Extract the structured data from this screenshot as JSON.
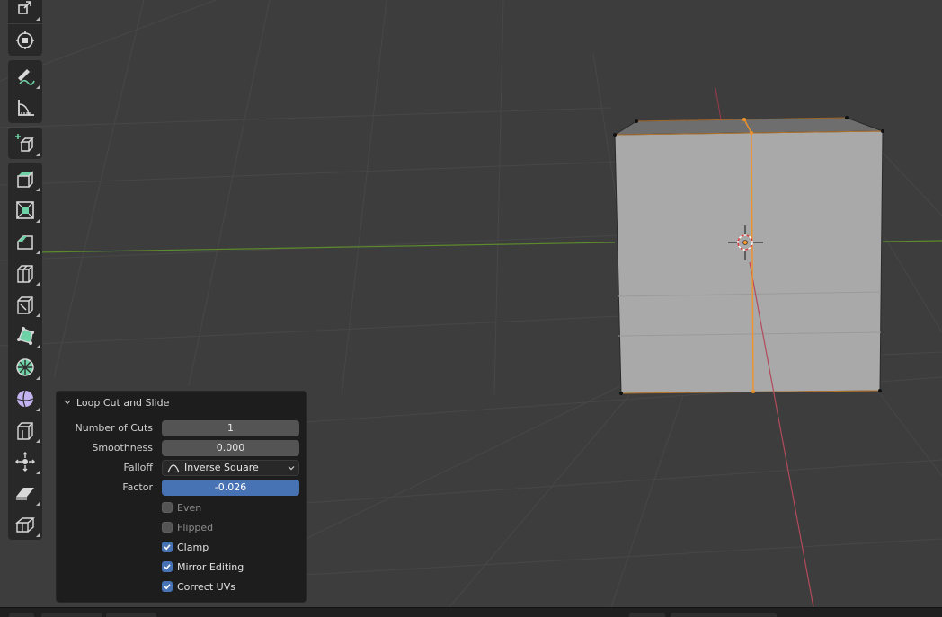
{
  "toolbar": {
    "tools": [
      {
        "name": "scale-icon",
        "active": false
      },
      {
        "name": "transform-icon",
        "active": false
      },
      {
        "name": "annotate-icon",
        "active": false
      },
      {
        "name": "measure-icon",
        "active": false
      },
      {
        "name": "add-cube-icon",
        "active": false
      },
      {
        "name": "extrude-region-icon",
        "active": false
      },
      {
        "name": "inset-faces-icon",
        "active": false
      },
      {
        "name": "bevel-icon",
        "active": false
      },
      {
        "name": "loop-cut-icon",
        "active": true
      },
      {
        "name": "knife-icon",
        "active": false
      },
      {
        "name": "poly-build-icon",
        "active": false
      },
      {
        "name": "spin-icon",
        "active": false
      },
      {
        "name": "smooth-icon",
        "active": false
      },
      {
        "name": "edge-slide-icon",
        "active": false
      },
      {
        "name": "shrink-fatten-icon",
        "active": false
      },
      {
        "name": "shear-icon",
        "active": false
      },
      {
        "name": "rip-region-icon",
        "active": false
      }
    ]
  },
  "operator_panel": {
    "title": "Loop Cut and Slide",
    "number_of_cuts": {
      "label": "Number of Cuts",
      "value": "1"
    },
    "smoothness": {
      "label": "Smoothness",
      "value": "0.000"
    },
    "falloff": {
      "label": "Falloff",
      "value": "Inverse Square"
    },
    "factor": {
      "label": "Factor",
      "value": "-0.026"
    },
    "even": {
      "label": "Even",
      "checked": false
    },
    "flipped": {
      "label": "Flipped",
      "checked": false
    },
    "clamp": {
      "label": "Clamp",
      "checked": true
    },
    "mirror_editing": {
      "label": "Mirror Editing",
      "checked": true
    },
    "correct_uvs": {
      "label": "Correct UVs",
      "checked": true
    }
  },
  "colors": {
    "viewport_bg": "#3d3d3d",
    "grid_line": "#4a4a4a",
    "x_axis": "#8c3a48",
    "y_axis": "#5c8a2c",
    "cube_face": "#a9a9a9",
    "selected_edge": "#f0922a",
    "accent_blue": "#4772b3"
  }
}
